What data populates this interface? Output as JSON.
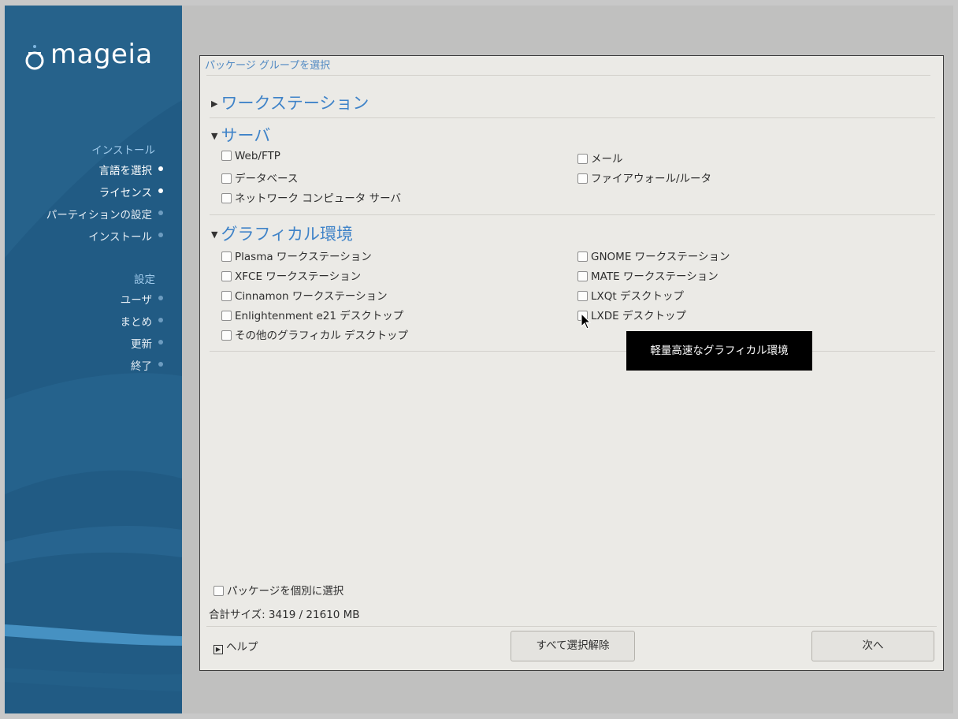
{
  "brand": "mageia",
  "sidebar": {
    "sections": [
      {
        "title": "インストール",
        "items": [
          {
            "label": "言語を選択",
            "done": true
          },
          {
            "label": "ライセンス",
            "done": true
          },
          {
            "label": "パーティションの設定",
            "done": false
          },
          {
            "label": "インストール",
            "done": false
          }
        ]
      },
      {
        "title": "設定",
        "items": [
          {
            "label": "ユーザ",
            "done": false
          },
          {
            "label": "まとめ",
            "done": false
          },
          {
            "label": "更新",
            "done": false
          },
          {
            "label": "終了",
            "done": false
          }
        ]
      }
    ]
  },
  "panel": {
    "title": "パッケージ グループを選択",
    "groups": [
      {
        "title": "ワークステーション",
        "expanded": false,
        "options": []
      },
      {
        "title": "サーバ",
        "expanded": true,
        "options": [
          "Web/FTP",
          "メール",
          "データベース",
          "ファイアウォール/ルータ",
          "ネットワーク コンピュータ サーバ"
        ]
      },
      {
        "title": "グラフィカル環境",
        "expanded": true,
        "options": [
          "Plasma ワークステーション",
          "GNOME ワークステーション",
          "XFCE ワークステーション",
          "MATE ワークステーション",
          "Cinnamon ワークステーション",
          "LXQt デスクトップ",
          "Enlightenment e21 デスクトップ",
          "LXDE デスクトップ",
          "その他のグラフィカル デスクトップ"
        ]
      }
    ],
    "tooltip": "軽量高速なグラフィカル環境",
    "individual_select": "パッケージを個別に選択",
    "total_size": "合計サイズ: 3419 / 21610 MB",
    "help": "ヘルプ",
    "deselect_all": "すべて選択解除",
    "next": "次へ"
  },
  "colors": {
    "sidebar_bg": "#215b84",
    "accent": "#3f83c8",
    "tooltip_bg": "#000000"
  }
}
